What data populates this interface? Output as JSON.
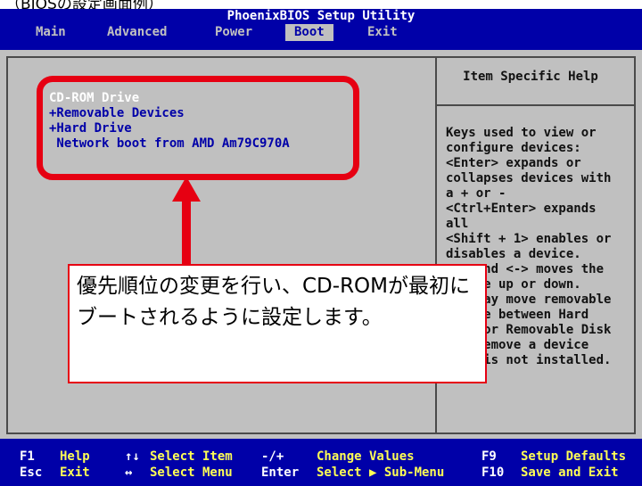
{
  "caption": "（BIOSの設定画面例）",
  "window": {
    "title": "PhoenixBIOS Setup Utility"
  },
  "menu": {
    "items": [
      {
        "label": "Main"
      },
      {
        "label": "Advanced"
      },
      {
        "label": "Power"
      },
      {
        "label": "Boot",
        "active": true
      },
      {
        "label": "Exit"
      }
    ]
  },
  "boot_list": {
    "items": [
      {
        "label": "CD-ROM Drive",
        "selected": true
      },
      {
        "label": "+Removable Devices"
      },
      {
        "label": "+Hard Drive"
      },
      {
        "label": " Network boot from AMD Am79C970A"
      }
    ]
  },
  "help": {
    "title": "Item Specific Help",
    "body": "Keys used to view or\nconfigure devices:\n<Enter> expands or\ncollapses devices with\na + or -\n<Ctrl+Enter> expands\nall\n<Shift + 1> enables or\ndisables a device.\n<+> and <-> moves the\ndevice up or down.\n<n> May move removable\ndevice between Hard\nDisk or Removable Disk\n<d> Remove a device\nthat is not installed."
  },
  "statusbar": {
    "row1": [
      {
        "key": "F1",
        "desc": "Help"
      },
      {
        "key": "↑↓",
        "desc": "Select Item"
      },
      {
        "key": "-/+",
        "desc": "Change Values"
      },
      {
        "key": "F9",
        "desc": "Setup Defaults"
      }
    ],
    "row2": [
      {
        "key": "Esc",
        "desc": "Exit"
      },
      {
        "key": "↔",
        "desc": "Select Menu"
      },
      {
        "key": "Enter",
        "desc": "Select ▶ Sub-Menu"
      },
      {
        "key": "F10",
        "desc": "Save and Exit"
      }
    ]
  },
  "annotation": {
    "callout_text": "優先順位の変更を行い、CD-ROMが最初にブートされるように設定します。",
    "color": "#e60012"
  },
  "colors": {
    "bios_blue": "#0000a8",
    "bios_gray": "#c0c0c0",
    "highlight_yellow": "#ffff55"
  }
}
